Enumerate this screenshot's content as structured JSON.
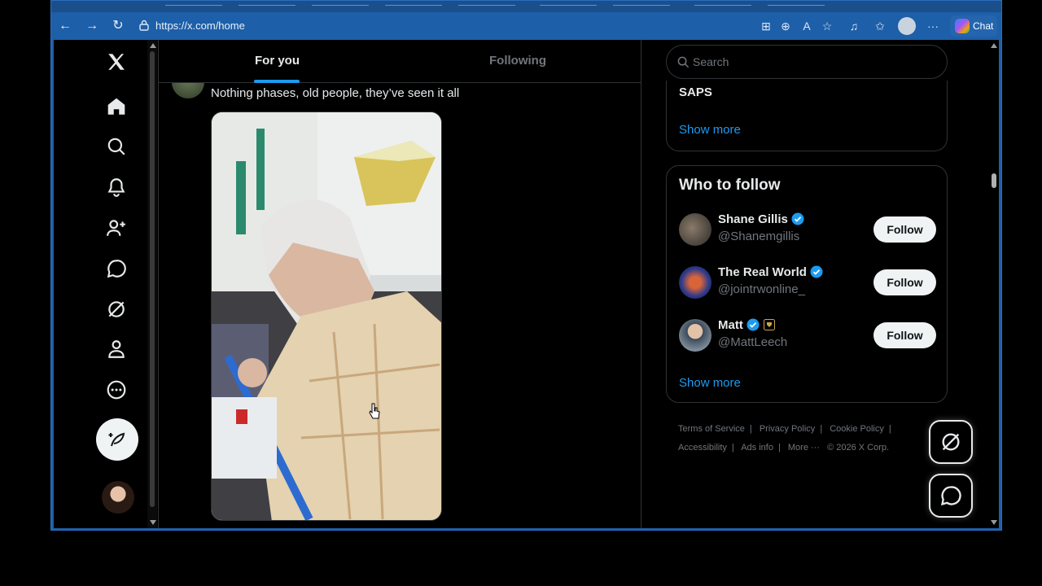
{
  "browser": {
    "url": "https://x.com/home",
    "chat_label": "Chat"
  },
  "tabs": {
    "for_you": "For you",
    "following": "Following"
  },
  "tweet": {
    "text": "Nothing phases, old people, they’ve seen it all"
  },
  "search": {
    "placeholder": "Search"
  },
  "trending": {
    "last_item": "SAPS",
    "show_more": "Show more"
  },
  "who_to_follow": {
    "title": "Who to follow",
    "accounts": [
      {
        "name": "Shane Gillis",
        "handle": "@Shanemgillis",
        "follow_label": "Follow"
      },
      {
        "name": "The Real World",
        "handle": "@jointrwonline_",
        "follow_label": "Follow"
      },
      {
        "name": "Matt",
        "handle": "@MattLeech",
        "follow_label": "Follow"
      }
    ],
    "show_more": "Show more"
  },
  "footer": {
    "terms": "Terms of Service",
    "privacy": "Privacy Policy",
    "cookie": "Cookie Policy",
    "accessibility": "Accessibility",
    "ads": "Ads info",
    "more": "More ···",
    "copyright": "© 2026 X Corp."
  },
  "colors": {
    "accent": "#1d9bf0",
    "browser_frame": "#1d5fa8",
    "background": "#000000"
  },
  "icons": [
    "x-logo-icon",
    "home-icon",
    "search-icon",
    "bell-icon",
    "people-icon",
    "message-icon",
    "grok-icon",
    "profile-icon",
    "more-icon",
    "compose-icon"
  ]
}
